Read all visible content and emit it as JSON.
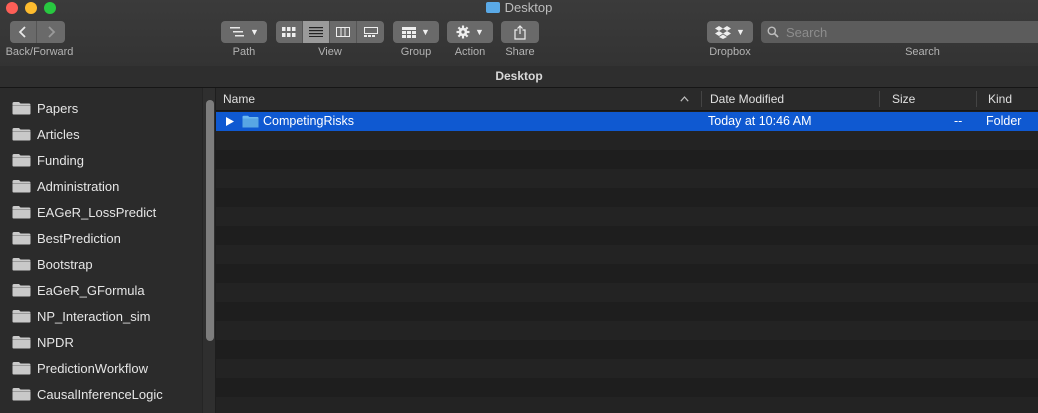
{
  "window": {
    "title": "Desktop"
  },
  "toolbar": {
    "back_forward_label": "Back/Forward",
    "path_label": "Path",
    "view_label": "View",
    "group_label": "Group",
    "action_label": "Action",
    "share_label": "Share",
    "dropbox_label": "Dropbox",
    "search_label": "Search",
    "search_placeholder": "Search",
    "active_view": "list"
  },
  "pathbar": {
    "title": "Desktop"
  },
  "sidebar": {
    "items": [
      {
        "label": "Papers"
      },
      {
        "label": "Articles"
      },
      {
        "label": "Funding"
      },
      {
        "label": "Administration"
      },
      {
        "label": "EAGeR_LossPredict"
      },
      {
        "label": "BestPrediction"
      },
      {
        "label": "Bootstrap"
      },
      {
        "label": "EaGeR_GFormula"
      },
      {
        "label": "NP_Interaction_sim"
      },
      {
        "label": "NPDR"
      },
      {
        "label": "PredictionWorkflow"
      },
      {
        "label": "CausalInferenceLogic"
      }
    ]
  },
  "list": {
    "columns": {
      "name": "Name",
      "date_modified": "Date Modified",
      "size": "Size",
      "kind": "Kind"
    },
    "rows": [
      {
        "name": "CompetingRisks",
        "date_modified": "Today at 10:46 AM",
        "size": "--",
        "kind": "Folder",
        "selected": true
      }
    ]
  },
  "colors": {
    "selection": "#0f59d1",
    "folder": "#5aa9e6"
  }
}
